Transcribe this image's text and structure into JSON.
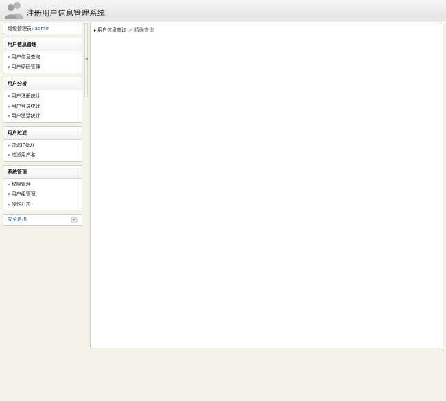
{
  "header": {
    "title": "注册用户信息管理系统",
    "logo_icon": "users-icon"
  },
  "admin": {
    "label": "超级管理员:",
    "name": "admin"
  },
  "sidebar": {
    "sections": [
      {
        "title": "用户信息管理",
        "items": [
          "用户信息查询",
          "用户密码管理"
        ]
      },
      {
        "title": "用户分析",
        "items": [
          "用户注册统计",
          "用户登录统计",
          "用户激活统计"
        ]
      },
      {
        "title": "用户过滤",
        "items": [
          "过滤IP(段)",
          "过滤用户名"
        ]
      },
      {
        "title": "系统管理",
        "items": [
          "权限管理",
          "用户组管理",
          "操作日志"
        ]
      }
    ],
    "logout": "安全退出"
  },
  "breadcrumb": {
    "parent": "用户信息查询",
    "separator": ">",
    "current": "精确查询"
  },
  "colors": {
    "background": "#f3f3ea",
    "link": "#1a4a8a",
    "border": "#cfcfcf"
  }
}
